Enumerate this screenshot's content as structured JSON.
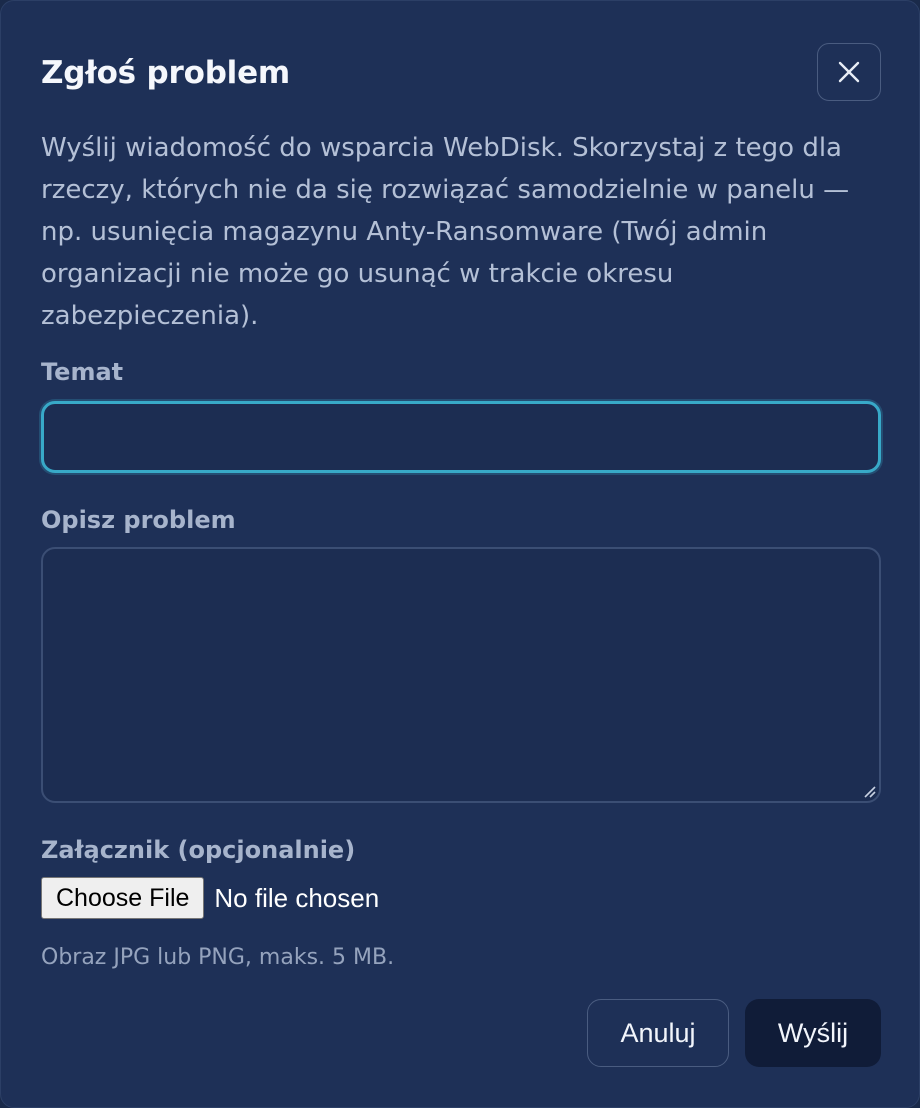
{
  "dialog": {
    "title": "Zgłoś problem",
    "description": "Wyślij wiadomość do wsparcia WebDisk. Skorzystaj z tego dla rzeczy, których nie da się rozwiązać samodzielnie w panelu — np. usunięcia magazynu Anty-Ransomware (Twój admin organizacji nie może go usunąć w trakcie okresu zabezpieczenia).",
    "close_icon": "close-icon"
  },
  "form": {
    "subject": {
      "label": "Temat",
      "value": "",
      "placeholder": ""
    },
    "message": {
      "label": "Opisz problem",
      "value": "",
      "placeholder": ""
    },
    "attachment": {
      "label": "Załącznik (opcjonalnie)",
      "button_label": "Choose File",
      "status": "No file chosen",
      "hint": "Obraz JPG lub PNG, maks. 5 MB."
    }
  },
  "actions": {
    "cancel_label": "Anuluj",
    "send_label": "Wyślij"
  },
  "colors": {
    "background": "#1e3057",
    "focus_ring": "#38a9c8",
    "primary_button": "#101c38"
  }
}
